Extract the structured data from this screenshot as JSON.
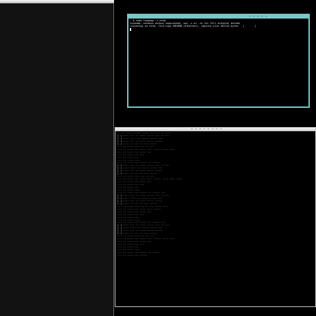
{
  "left_window": {
    "title": ""
  },
  "term_top": {
    "title": "— — — — —",
    "lines": [
      "~ $ sudo tcpdump -i eth0",
      "tcpdump: verbose output suppressed, use -v or -vv for full protocol decode",
      "listening on eth0, link-type EN10MB (Ethernet), capture size 262144 bytes   [ . . . ]"
    ],
    "border_color": "#7cc6c6"
  },
  "term_bottom": {
    "title": "— — — — — — — —",
    "lines": [
      "-- -- ---- ------ ---- ------- -- ----",
      "",
      "[ ] ---- --- -- ---- ----- --- -- ---",
      "[ ] ---- ---- -- ----- ----- ---",
      "[ ] ---- --- -- ---- ----- -----",
      "[ ] ---- -- --- -- --- -----",
      "",
      "--- -- ---- ---- -- -- ---",
      "--- -- ---- --- ---- ---- ----- ---- ----",
      "--- -- ---- --- ---- ---",
      "--- -- ---- --- ---",
      "--- -- ---- ---",
      "--- -- ---- ----",
      "--- -- ---- --- ----- -- -----",
      "",
      "[ ] ---- --- -- ---- ----- --- -- ---",
      "[ ] ---- ---- -- ----- ----- ---",
      "[ ] ---- --- -- ---- ----- -----",
      "[ ] ---- -- --- -- --- -----",
      "",
      "--- -- ---- ---- -- -- ---",
      "--- -- ---- --- ---- ---- ----- ---- ---- ----",
      "--- -- ---- --- ---- ---",
      "--- -- ---- --- ---",
      "--- -- ---- ---",
      "--- -- ---- ----",
      "--- -- ---- --- ----- -- ----- ---",
      "",
      "[ ] ---- --- -- ---- ----- --- -- ---",
      "[ ] ---- ---- -- ----- ----- ---",
      "[ ] ---- --- -- ---- ----- -----",
      "[ ] ---- -- --- -- --- -----",
      "",
      "--- -- ---- ---- -- -- --- ---- ----",
      "--- -- ---- --- ---- ---- -----",
      "--- -- ---- --- ---- ---",
      "--- -- ---- --- ---",
      "--- -- ---- ---",
      "--- -- ---- ----",
      "--- -- ---- --- ----- -- ----- ---",
      "",
      "[ ] ---- --- -- ---- ----- --- -- ---",
      "[ ] ---- ---- -- ----- ----- ---",
      "[ ] ---- --- -- ---- ----- -----",
      "[ ] ---- -- --- -- --- -----",
      "",
      "--- -- ---- ---- -- -- ---",
      "--- -- ---- --- ---- ---- ----- ---- ----",
      "--- -- ---- --- ---- ---",
      "--- -- ---- --- ---",
      "--- -- ---- ---",
      "--- -- ---- ----",
      "--- -- ---- --- ----- -- -----",
      "--- -- ---- --- -----"
    ]
  }
}
